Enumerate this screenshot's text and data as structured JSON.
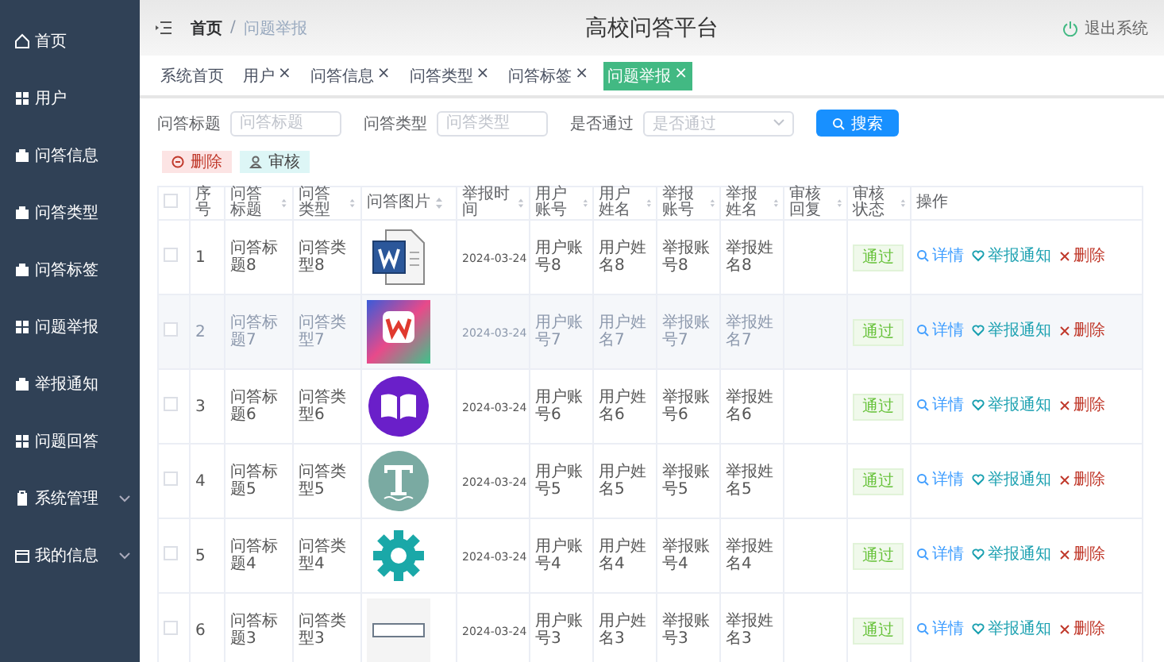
{
  "sidebar": {
    "items": [
      {
        "label": "首页",
        "selected": false,
        "expandable": false
      },
      {
        "label": "用户",
        "selected": false,
        "expandable": false
      },
      {
        "label": "问答信息",
        "selected": false,
        "expandable": false
      },
      {
        "label": "问答类型",
        "selected": false,
        "expandable": false
      },
      {
        "label": "问答标签",
        "selected": false,
        "expandable": false
      },
      {
        "label": "问题举报",
        "selected": false,
        "expandable": false
      },
      {
        "label": "举报通知",
        "selected": false,
        "expandable": false
      },
      {
        "label": "问题回答",
        "selected": false,
        "expandable": false
      },
      {
        "label": "系统管理",
        "selected": false,
        "expandable": true
      },
      {
        "label": "我的信息",
        "selected": false,
        "expandable": true
      }
    ]
  },
  "header": {
    "breadcrumbs": [
      "首页",
      "问题举报"
    ],
    "breadcrumb_separator": "/",
    "title": "高校问答平台",
    "logout": "退出系统"
  },
  "tabs": [
    {
      "label": "系统首页",
      "selected": false
    },
    {
      "label": "用户",
      "close": "×",
      "selected": false
    },
    {
      "label": "问答信息",
      "close": "×",
      "selected": false
    },
    {
      "label": "问答类型",
      "close": "×",
      "selected": false
    },
    {
      "label": "问答标签",
      "close": "×",
      "selected": false
    },
    {
      "label": "问题举报",
      "close": "×",
      "selected": true
    }
  ],
  "filters": [
    {
      "kind": "input",
      "label": "问答标题",
      "placeholder": "问答标题"
    },
    {
      "kind": "input",
      "label": "问答类型",
      "placeholder": "问答类型"
    },
    {
      "kind": "select",
      "label": "是否通过",
      "placeholder": "是否通过"
    }
  ],
  "search_button": "搜索",
  "actions": [
    {
      "kind": "danger",
      "label": "删除"
    },
    {
      "kind": "info",
      "label": "审核"
    }
  ],
  "table": {
    "header_checked": false,
    "columns": [
      {
        "label": "序号",
        "sortable": false
      },
      {
        "label": "问答标题",
        "sortable": true
      },
      {
        "label": "问答类型",
        "sortable": true
      },
      {
        "label": "问答图片",
        "sortable": true
      },
      {
        "label": "举报时间",
        "sortable": true
      },
      {
        "label": "用户账号",
        "sortable": true
      },
      {
        "label": "用户姓名",
        "sortable": true
      },
      {
        "label": "举报账号",
        "sortable": true
      },
      {
        "label": "举报姓名",
        "sortable": true
      },
      {
        "label": "审核回复",
        "sortable": true
      },
      {
        "label": "审核状态",
        "sortable": true
      },
      {
        "label": "操作",
        "sortable": false
      }
    ],
    "rows": [
      {
        "checked": false,
        "highlighted": false,
        "cells": [
          "1",
          "问答标题8",
          "问答类型8"
        ],
        "rest": [
          "2024-03-24",
          "用户账号8",
          "用户姓名8",
          "举报账号8",
          "举报姓名8"
        ],
        "status": "通过",
        "approved": true,
        "actions": [
          {
            "kind": "detail",
            "label": "详情"
          },
          {
            "kind": "notify",
            "label": "举报通知"
          },
          {
            "kind": "delete",
            "label": "删除"
          }
        ]
      },
      {
        "checked": false,
        "highlighted": true,
        "cells": [
          "2",
          "问答标题7",
          "问答类型7"
        ],
        "rest": [
          "2024-03-24",
          "用户账号7",
          "用户姓名7",
          "举报账号7",
          "举报姓名7"
        ],
        "status": "通过",
        "approved": true,
        "actions": [
          {
            "kind": "detail",
            "label": "详情"
          },
          {
            "kind": "notify",
            "label": "举报通知"
          },
          {
            "kind": "delete",
            "label": "删除"
          }
        ]
      },
      {
        "checked": false,
        "highlighted": false,
        "cells": [
          "3",
          "问答标题6",
          "问答类型6"
        ],
        "rest": [
          "2024-03-24",
          "用户账号6",
          "用户姓名6",
          "举报账号6",
          "举报姓名6"
        ],
        "status": "通过",
        "approved": true,
        "actions": [
          {
            "kind": "detail",
            "label": "详情"
          },
          {
            "kind": "notify",
            "label": "举报通知"
          },
          {
            "kind": "delete",
            "label": "删除"
          }
        ]
      },
      {
        "checked": false,
        "highlighted": false,
        "cells": [
          "4",
          "问答标题5",
          "问答类型5"
        ],
        "rest": [
          "2024-03-24",
          "用户账号5",
          "用户姓名5",
          "举报账号5",
          "举报姓名5"
        ],
        "status": "通过",
        "approved": true,
        "actions": [
          {
            "kind": "detail",
            "label": "详情"
          },
          {
            "kind": "notify",
            "label": "举报通知"
          },
          {
            "kind": "delete",
            "label": "删除"
          }
        ]
      },
      {
        "checked": false,
        "highlighted": false,
        "cells": [
          "5",
          "问答标题4",
          "问答类型4"
        ],
        "rest": [
          "2024-03-24",
          "用户账号4",
          "用户姓名4",
          "举报账号4",
          "举报姓名4"
        ],
        "status": "通过",
        "approved": true,
        "actions": [
          {
            "kind": "detail",
            "label": "详情"
          },
          {
            "kind": "notify",
            "label": "举报通知"
          },
          {
            "kind": "delete",
            "label": "删除"
          }
        ]
      },
      {
        "checked": false,
        "highlighted": false,
        "cells": [
          "6",
          "问答标题3",
          "问答类型3"
        ],
        "rest": [
          "2024-03-24",
          "用户账号3",
          "用户姓名3",
          "举报账号3",
          "举报姓名3"
        ],
        "status": "通过",
        "approved": true,
        "actions": [
          {
            "kind": "detail",
            "label": "详情"
          },
          {
            "kind": "notify",
            "label": "举报通知"
          },
          {
            "kind": "delete",
            "label": "删除"
          }
        ]
      }
    ]
  }
}
